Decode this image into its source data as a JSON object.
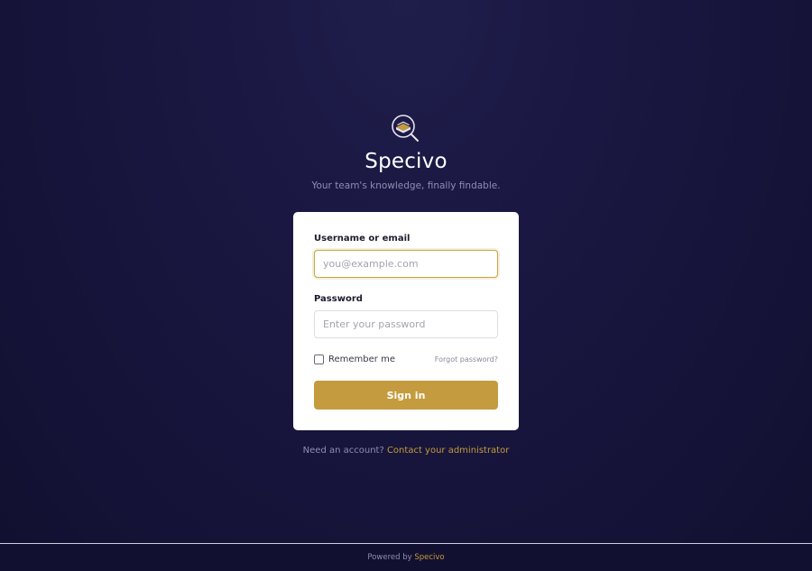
{
  "brand": {
    "logo_icon": "book-magnifier-icon",
    "name": "Specivo",
    "tagline": "Your team's knowledge, finally findable."
  },
  "login": {
    "username_label": "Username or email",
    "username_placeholder": "you@example.com",
    "username_value": "",
    "password_label": "Password",
    "password_placeholder": "Enter your password",
    "password_value": "",
    "remember_label": "Remember me",
    "remember_checked": false,
    "forgot_label": "Forgot password?",
    "submit_label": "Sign in"
  },
  "signup": {
    "prompt": "Need an account?",
    "link_label": "Contact your administrator"
  },
  "footer": {
    "prefix": "Powered by",
    "brand": "Specivo"
  },
  "colors": {
    "accent": "#c49b3e",
    "background": "#1a1842",
    "card": "#ffffff",
    "focus_border": "#c9a441"
  }
}
